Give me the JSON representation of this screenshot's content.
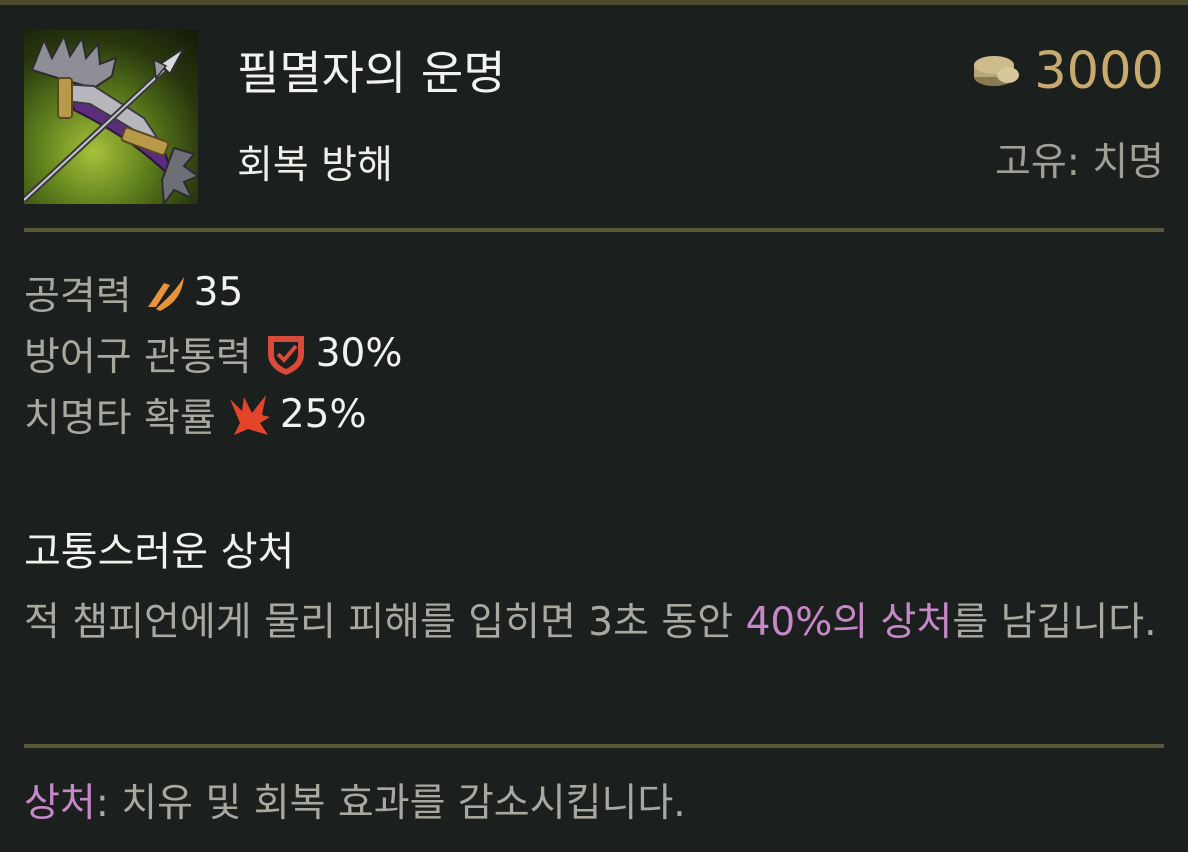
{
  "item": {
    "name": "필멸자의 운명",
    "tag": "회복 방해",
    "price": "3000",
    "unique": "고유: 치명",
    "icon": "crossbow-item-icon"
  },
  "stats": [
    {
      "label": "공격력",
      "icon": "attack-damage-icon",
      "value": "35"
    },
    {
      "label": "방어구 관통력",
      "icon": "armor-penetration-icon",
      "value": "30%"
    },
    {
      "label": "치명타 확률",
      "icon": "critical-strike-icon",
      "value": "25%"
    }
  ],
  "passive": {
    "title": "고통스러운 상처",
    "desc_before": "적 챔피언에게 물리 피해를 입히면 3초 동안 ",
    "desc_keyword": "40%의 상처",
    "desc_after": "를 남깁니다."
  },
  "footnote": {
    "keyword": "상처",
    "text": ": 치유 및 회복 효과를 감소시킵니다."
  },
  "colors": {
    "background": "#1b201f",
    "gold": "#c8aa6e",
    "keyword": "#c888c8",
    "divider": "#5a5638",
    "muted_text": "#a9a89f",
    "attack_damage": "#e8923a",
    "armor_penetration": "#d84a3a",
    "critical_strike": "#e4452a"
  },
  "icons": {
    "price": "gold-coin-icon"
  }
}
